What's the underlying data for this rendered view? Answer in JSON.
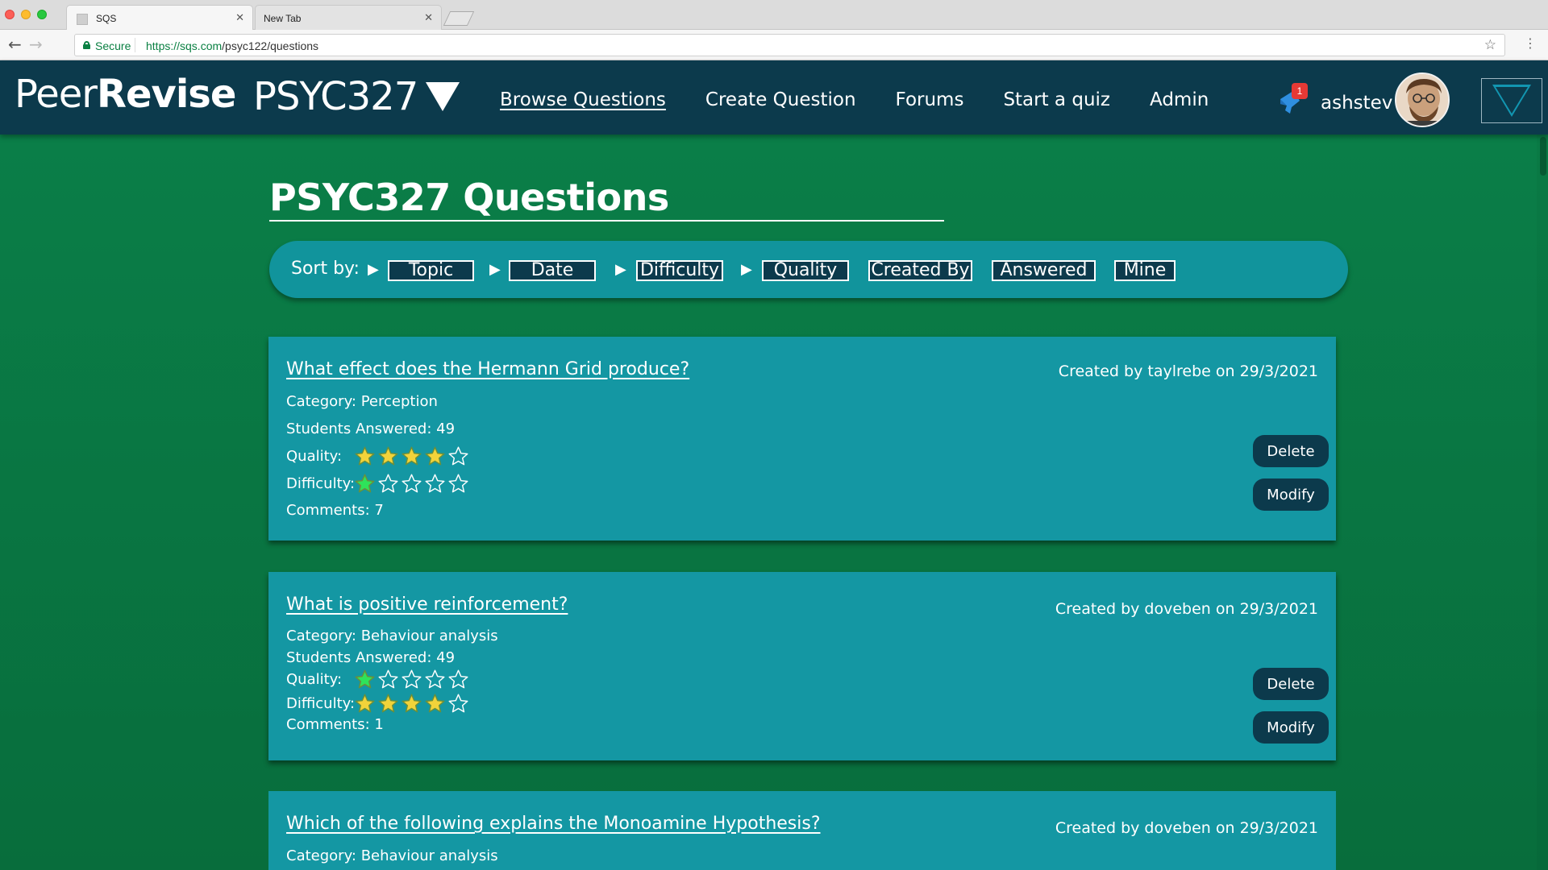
{
  "browser": {
    "tabs": [
      {
        "title": "SQS",
        "active": true
      },
      {
        "title": "New Tab",
        "active": false
      }
    ],
    "secure_label": "Secure",
    "url_host": "https://sqs.com",
    "url_path": "/psyc122/questions"
  },
  "header": {
    "logo_light": "Peer",
    "logo_bold": "Revise",
    "course": "PSYC327",
    "nav": [
      {
        "label": "Browse Questions",
        "active": true
      },
      {
        "label": "Create Question",
        "active": false
      },
      {
        "label": "Forums",
        "active": false
      },
      {
        "label": "Start a quiz",
        "active": false
      },
      {
        "label": "Admin",
        "active": false
      }
    ],
    "notification_count": "1",
    "username": "ashstev"
  },
  "page": {
    "title": "PSYC327 Questions",
    "sort": {
      "label": "Sort by:",
      "options": [
        "Topic",
        "Date",
        "Difficulty",
        "Quality",
        "Created By",
        "Answered",
        "Mine"
      ]
    }
  },
  "questions": [
    {
      "title": "What effect does the Hermann Grid produce?",
      "created": "Created by taylrebe on 29/3/2021",
      "category": "Category: Perception",
      "answered": "Students Answered: 49",
      "quality_label": "Quality:",
      "quality": 4,
      "difficulty_label": "Difficulty:",
      "difficulty": 1,
      "comments": "Comments: 7",
      "delete_label": "Delete",
      "modify_label": "Modify"
    },
    {
      "title": "What is positive reinforcement?",
      "created": "Created by doveben on 29/3/2021",
      "category": "Category:  Behaviour analysis",
      "answered": "Students Answered: 49",
      "quality_label": "Quality:",
      "quality": 1,
      "difficulty_label": "Difficulty:",
      "difficulty": 4,
      "comments": "Comments: 1",
      "delete_label": "Delete",
      "modify_label": "Modify"
    },
    {
      "title": "Which of the following explains the Monoamine Hypothesis?",
      "created": "Created by doveben on 29/3/2021",
      "category": "Category:  Behaviour analysis"
    }
  ],
  "colors": {
    "header_bg": "#0c3a4c",
    "page_bg": "#0a7e48",
    "card_bg": "#1497a3",
    "star_gold": "#f2d33a",
    "star_green": "#2ee35a"
  },
  "icons": {
    "star_filled": "star-filled-icon",
    "star_empty": "star-outline-icon",
    "notification": "notification-bell-icon",
    "menu": "dropdown-triangle-icon"
  }
}
